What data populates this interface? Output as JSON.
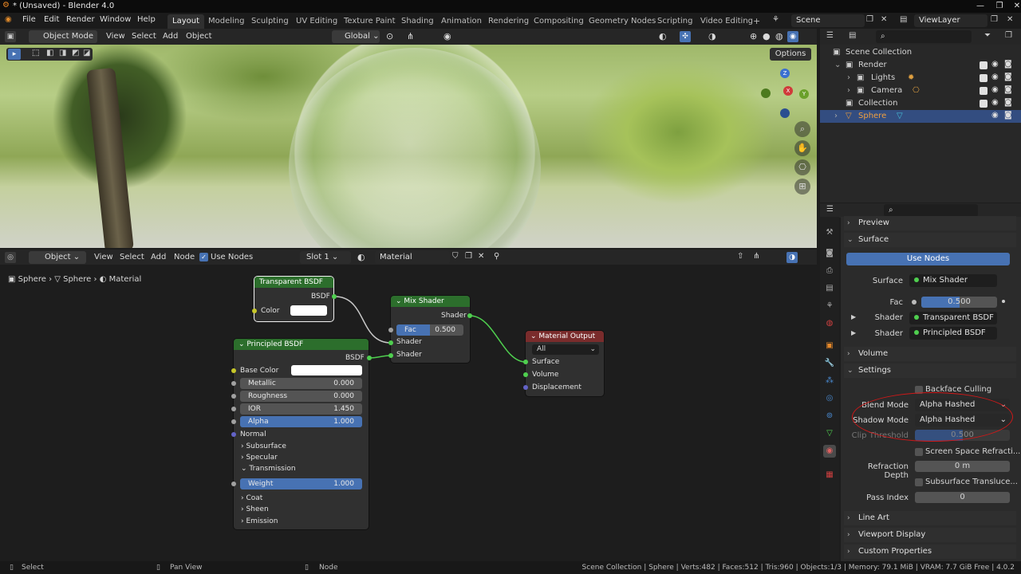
{
  "window": {
    "title": "* (Unsaved) - Blender 4.0"
  },
  "menu": [
    "File",
    "Edit",
    "Render",
    "Window",
    "Help"
  ],
  "workspaces": [
    "Layout",
    "Modeling",
    "Sculpting",
    "UV Editing",
    "Texture Paint",
    "Shading",
    "Animation",
    "Rendering",
    "Compositing",
    "Geometry Nodes",
    "Scripting",
    "Video Editing"
  ],
  "scene": {
    "name": "Scene",
    "view_layer": "ViewLayer"
  },
  "viewport_header": {
    "mode": "Object Mode",
    "menus": [
      "View",
      "Select",
      "Add",
      "Object"
    ],
    "orientation": "Global",
    "options": "Options"
  },
  "node_header": {
    "editor_type": "Object",
    "menus": [
      "View",
      "Select",
      "Add",
      "Node"
    ],
    "use_nodes": "Use Nodes",
    "slot": "Slot 1",
    "material": "Material"
  },
  "breadcrumb": {
    "obj1": "Sphere",
    "obj2": "Sphere",
    "mat": "Material"
  },
  "nodes": {
    "transparent": {
      "title": "Transparent BSDF",
      "out": "BSDF",
      "color_label": "Color"
    },
    "mix": {
      "title": "Mix Shader",
      "out": "Shader",
      "fac_label": "Fac",
      "fac_value": "0.500",
      "in1": "Shader",
      "in2": "Shader"
    },
    "output": {
      "title": "Material Output",
      "target": "All",
      "surface": "Surface",
      "volume": "Volume",
      "displacement": "Displacement"
    },
    "principled": {
      "title": "Principled BSDF",
      "out": "BSDF",
      "base_color": "Base Color",
      "metallic": "Metallic",
      "metallic_v": "0.000",
      "roughness": "Roughness",
      "roughness_v": "0.000",
      "ior": "IOR",
      "ior_v": "1.450",
      "alpha": "Alpha",
      "alpha_v": "1.000",
      "normal": "Normal",
      "subsurface": "Subsurface",
      "specular": "Specular",
      "transmission": "Transmission",
      "weight": "Weight",
      "weight_v": "1.000",
      "coat": "Coat",
      "sheen": "Sheen",
      "emission": "Emission"
    }
  },
  "outliner": {
    "root": "Scene Collection",
    "items": [
      {
        "label": "Render"
      },
      {
        "label": "Lights"
      },
      {
        "label": "Camera"
      },
      {
        "label": "Collection"
      },
      {
        "label": "Sphere"
      }
    ]
  },
  "properties": {
    "preview": "Preview",
    "surface_sec": "Surface",
    "use_nodes_btn": "Use Nodes",
    "surface_label": "Surface",
    "surface_value": "Mix Shader",
    "fac_label": "Fac",
    "fac_value": "0.500",
    "shader_label1": "Shader",
    "shader_value1": "Transparent BSDF",
    "shader_label2": "Shader",
    "shader_value2": "Principled BSDF",
    "volume_sec": "Volume",
    "settings_sec": "Settings",
    "backface": "Backface Culling",
    "blend_label": "Blend Mode",
    "blend_value": "Alpha Hashed",
    "shadow_label": "Shadow Mode",
    "shadow_value": "Alpha Hashed",
    "clip_label": "Clip Threshold",
    "clip_value": "0.500",
    "ssr": "Screen Space Refracti...",
    "refr_label": "Refraction Depth",
    "refr_value": "0 m",
    "sst": "Subsurface Transluce...",
    "pass_label": "Pass Index",
    "pass_value": "0",
    "line_art": "Line Art",
    "viewport_display": "Viewport Display",
    "custom_props": "Custom Properties"
  },
  "status": {
    "select": "Select",
    "pan": "Pan View",
    "node": "Node",
    "info": "Scene Collection | Sphere | Verts:482 | Faces:512 | Tris:960 | Objects:1/3 | Memory: 79.1 MiB | VRAM: 7.7 GiB Free | 4.0.2"
  },
  "colors": {
    "accent": "#4772b3",
    "node_green": "#2c6e2c",
    "node_red": "#7a2c2c",
    "socket_green": "#4fcf4f",
    "highlight": "#d01818"
  }
}
